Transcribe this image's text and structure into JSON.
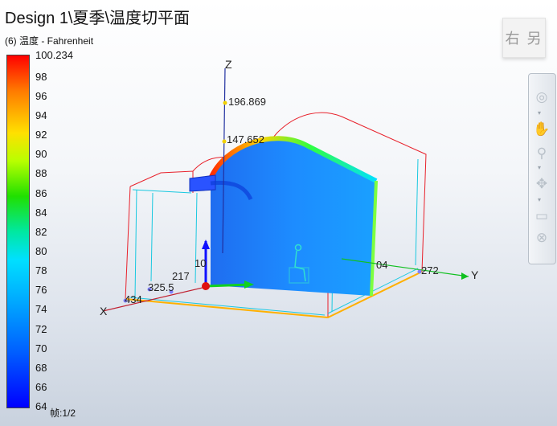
{
  "header": {
    "title": "Design 1\\夏季\\温度切平面",
    "subtitle": "(6) 温度 - Fahrenheit"
  },
  "legend": {
    "max_label": "100.234",
    "ticks": [
      "98",
      "96",
      "94",
      "92",
      "90",
      "88",
      "86",
      "84",
      "82",
      "80",
      "78",
      "76",
      "74",
      "72",
      "70",
      "68",
      "66",
      "64"
    ],
    "gradient_colors": [
      "#ff0000",
      "#ff7a00",
      "#ffe000",
      "#20e000",
      "#00e0ff",
      "#00a8ff",
      "#0000ff"
    ]
  },
  "axes": {
    "z_label": "Z",
    "y_label": "Y",
    "x_label": "X",
    "z_values": [
      "196.869",
      "147.652",
      "10"
    ],
    "x_values": [
      "217",
      "325.5",
      "434"
    ],
    "y_values": [
      "04",
      "272"
    ]
  },
  "footer": {
    "frame": "帧:1/2"
  },
  "view_cube": {
    "label": "右 另"
  },
  "nav_panel": {
    "icons": [
      "orbit-icon",
      "hand-pan-icon",
      "zoom-icon",
      "walk-icon",
      "rewind-icon",
      "wheel-icon"
    ]
  }
}
